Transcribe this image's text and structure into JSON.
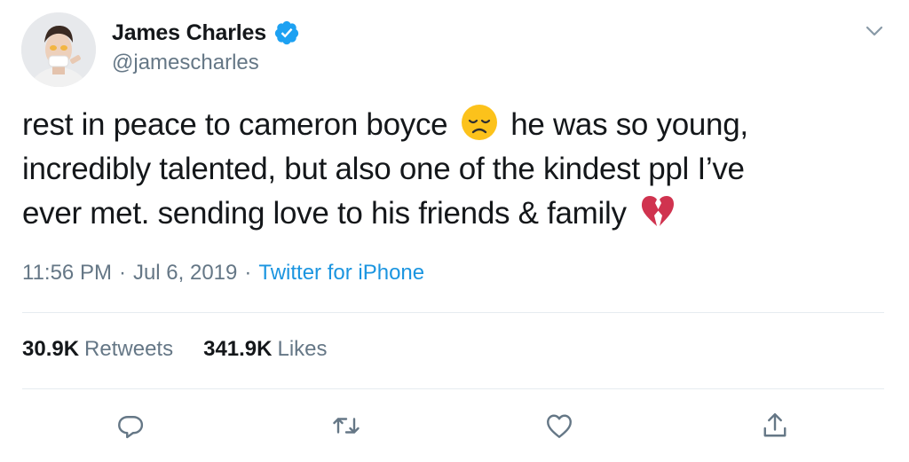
{
  "author": {
    "display_name": "James Charles",
    "handle": "@jamescharles",
    "verified": true
  },
  "tweet": {
    "line1_a": "rest in peace to cameron boyce",
    "emoji1": "disappointed-face-emoji",
    "line1_b": "he was so young,",
    "line2": "incredibly talented, but also one of the kindest ppl I’ve",
    "line3": "ever met. sending love to his friends & family",
    "emoji2": "broken-heart-emoji"
  },
  "meta": {
    "time": "11:56 PM",
    "sep1": "·",
    "date": "Jul 6, 2019",
    "sep2": "·",
    "source": "Twitter for iPhone"
  },
  "stats": {
    "retweets_count": "30.9K",
    "retweets_label": "Retweets",
    "likes_count": "341.9K",
    "likes_label": "Likes"
  },
  "colors": {
    "text": "#14171a",
    "secondary": "#657786",
    "link": "#1b95e0",
    "verified": "#1da1f2",
    "divider": "#e6ecf0"
  },
  "icons": [
    "verified-badge-icon",
    "chevron-down-icon",
    "reply-icon",
    "retweet-icon",
    "like-icon",
    "share-icon"
  ]
}
